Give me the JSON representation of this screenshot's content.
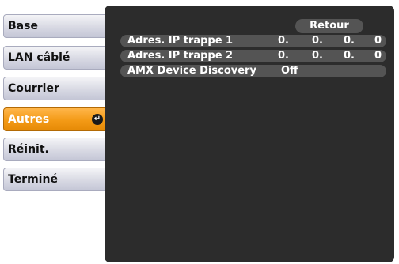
{
  "sidebar": {
    "items": [
      {
        "label": "Base"
      },
      {
        "label": "LAN câblé"
      },
      {
        "label": "Courrier"
      },
      {
        "label": "Autres"
      },
      {
        "label": "Réinit."
      },
      {
        "label": "Terminé"
      }
    ],
    "selected_index": 3,
    "selected_icon": "enter-icon"
  },
  "panel": {
    "return_label": "Retour",
    "rows": [
      {
        "label": "Adres. IP trappe 1",
        "octets": [
          "0.",
          "0.",
          "0.",
          "0"
        ]
      },
      {
        "label": "Adres. IP trappe 2",
        "octets": [
          "0.",
          "0.",
          "0.",
          "0"
        ]
      },
      {
        "label": "AMX Device Discovery",
        "value": "Off"
      }
    ]
  },
  "colors": {
    "selected_accent": "#f39a16",
    "panel_background": "#2c2c2c",
    "row_background": "#545454"
  }
}
